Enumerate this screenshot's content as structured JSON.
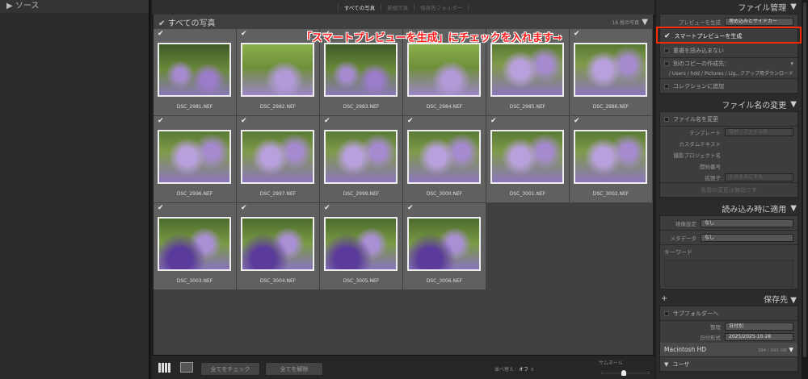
{
  "left": {
    "header": "ソース"
  },
  "topbar": {
    "tabs": [
      "すべての写真",
      "新規写真",
      "保存先フォルダー"
    ]
  },
  "gridhead": {
    "title": "すべての写真",
    "count": "16 枚の写真"
  },
  "photos": [
    "DSC_2981.NEF",
    "DSC_2982.NEF",
    "DSC_2983.NEF",
    "DSC_2984.NEF",
    "DSC_2985.NEF",
    "DSC_2986.NEF",
    "DSC_2996.NEF",
    "DSC_2997.NEF",
    "DSC_2999.NEF",
    "DSC_3000.NEF",
    "DSC_3001.NEF",
    "DSC_3002.NEF",
    "DSC_3003.NEF",
    "DSC_3004.NEF",
    "DSC_3005.NEF",
    "DSC_3006.NEF"
  ],
  "bottom": {
    "check_all": "全てをチェック",
    "uncheck_all": "全てを解除",
    "sort_label": "並べ替え：",
    "sort_value": "オフ",
    "thumb_label": "サムネール",
    "thumb_size": 0.45
  },
  "callout": "「スマートプレビューを生成」にチェックを入れます→",
  "file": {
    "title": "ファイル管理",
    "preview_label": "プレビューを生成",
    "preview_value": "埋め込みとサイドカー",
    "smart": "スマートプレビューを生成",
    "dup": "重複を読み込まない",
    "copy": "別のコピーの作成先：",
    "copy_path": "/ Users / hdd / Pictures / Lig...クアップ用ダウンロード",
    "collection": "コレクションに追加"
  },
  "rename": {
    "title": "ファイル名の変更",
    "rename": "ファイル名を変更",
    "template_label": "テンプレート",
    "template_value": "日付 - ファイル名",
    "custom": "カスタムテキスト",
    "project": "撮影プロジェクト名",
    "start": "開始番号",
    "ext_label": "拡張子",
    "ext_value": "そのままにする",
    "disabled": "名前の変更は無効です"
  },
  "apply": {
    "title": "読み込み時に適用",
    "dev_label": "現像設定",
    "dev_value": "なし",
    "meta_label": "メタデータ",
    "meta_value": "なし",
    "keywords": "キーワード"
  },
  "dest": {
    "title": "保存先",
    "subfolder": "サブフォルダーへ",
    "org_label": "整理",
    "org_value": "日付別",
    "date_label": "日付形式",
    "date_value": "2025/2025-10-28",
    "volume": "Macintosh HD",
    "space": "384 / 995 GB",
    "user": "ユーザ"
  }
}
